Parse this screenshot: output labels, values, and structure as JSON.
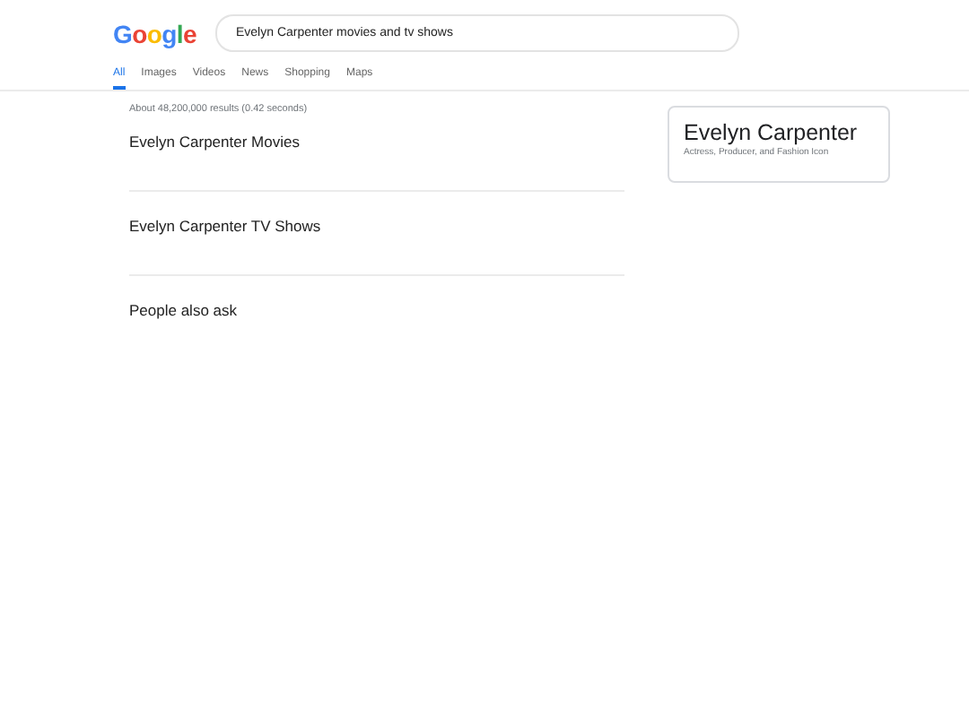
{
  "logo": "Google",
  "search": {
    "value": "Evelyn Carpenter movies and tv shows"
  },
  "tabs": [
    {
      "label": "All",
      "selected": true
    },
    {
      "label": "Images",
      "selected": false
    },
    {
      "label": "Videos",
      "selected": false
    },
    {
      "label": "News",
      "selected": false
    },
    {
      "label": "Shopping",
      "selected": false
    },
    {
      "label": "Maps",
      "selected": false
    }
  ],
  "result_stats": "About 48,200,000 results (0.42 seconds)",
  "sections": [
    "Evelyn Carpenter Movies",
    "Evelyn Carpenter TV Shows",
    "People also ask"
  ],
  "knowledge_panel": {
    "title": "Evelyn Carpenter",
    "subtitle": "Actress, Producer, and Fashion Icon"
  }
}
